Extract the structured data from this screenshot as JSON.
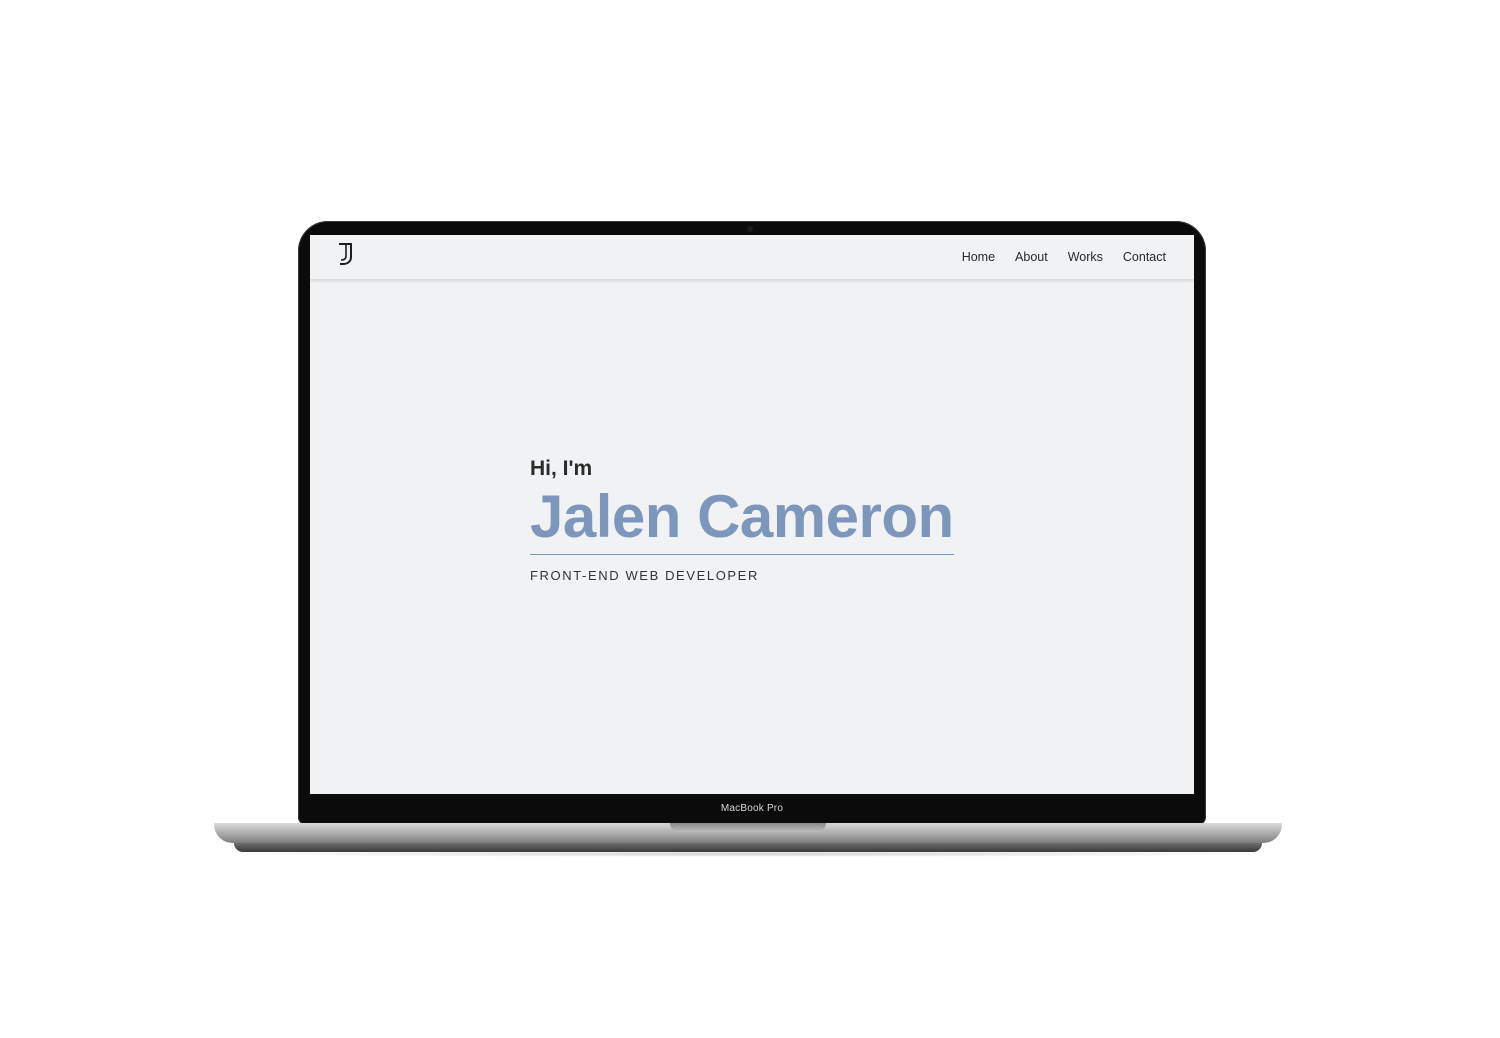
{
  "device": {
    "label": "MacBook Pro"
  },
  "site": {
    "logo": "J",
    "nav": {
      "items": [
        {
          "label": "Home"
        },
        {
          "label": "About"
        },
        {
          "label": "Works"
        },
        {
          "label": "Contact"
        }
      ]
    },
    "hero": {
      "greeting": "Hi, I'm",
      "name": "Jalen Cameron",
      "role": "FRONT-END WEB DEVELOPER"
    }
  },
  "colors": {
    "accent": "#7d96bb",
    "background": "#f1f2f4",
    "text": "#2b2b2b"
  }
}
